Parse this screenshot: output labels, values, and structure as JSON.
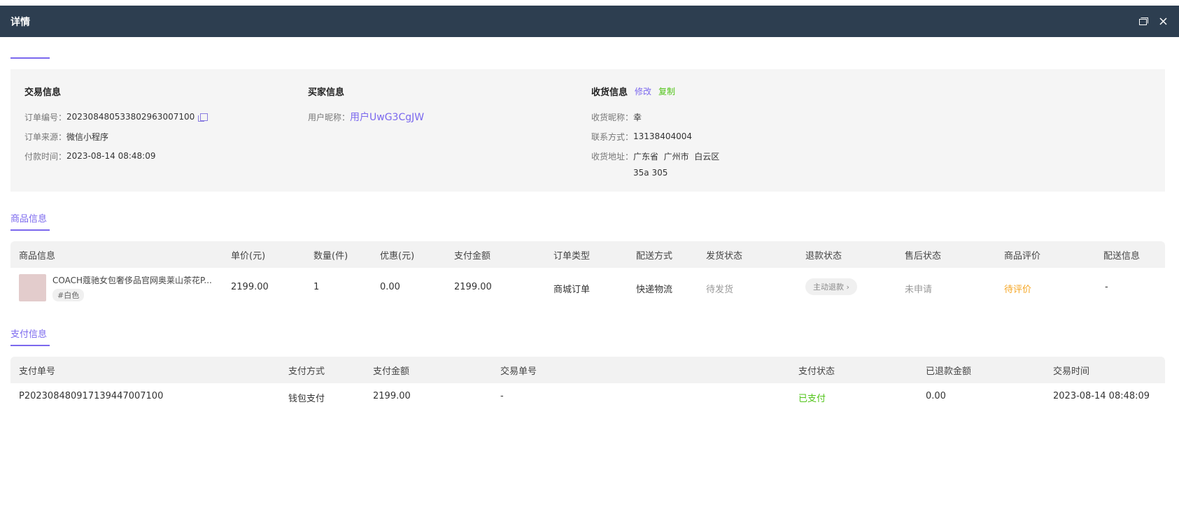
{
  "window": {
    "title": "详情",
    "restore_icon": "restore-window-icon",
    "close_icon": "close-icon"
  },
  "trade": {
    "heading": "交易信息",
    "order_no_label": "订单编号：",
    "order_no": "2023084805338029630071​00",
    "source_label": "订单来源：",
    "source": "微信小程序",
    "pay_time_label": "付款时间：",
    "pay_time": "2023-08-14 08:48:09"
  },
  "buyer": {
    "heading": "买家信息",
    "nick_label": "用户昵称：",
    "nick": "用户UwG3CgJW"
  },
  "receiver": {
    "heading": "收货信息",
    "edit_label": "修改",
    "copy_label": "复制",
    "name_label": "收货昵称：",
    "name": "幸",
    "phone_label": "联系方式：",
    "phone": "13138404004",
    "addr_label": "收货地址：",
    "addr_line1": "广东省  广州市  白云区",
    "addr_line2": "35a 305"
  },
  "goods": {
    "section_title": "商品信息",
    "headers": [
      "商品信息",
      "单价(元)",
      "数量(件)",
      "优惠(元)",
      "支付金额",
      "订单类型",
      "配送方式",
      "发货状态",
      "退款状态",
      "售后状态",
      "商品评价",
      "配送信息"
    ],
    "row": {
      "name": "COACH蔻驰女包奢侈品官网奥莱山茶花P...",
      "sku": "#白色",
      "price": "2199.00",
      "qty": "1",
      "discount": "0.00",
      "paid": "2199.00",
      "order_type": "商城订单",
      "delivery": "快递物流",
      "ship_status": "待发货",
      "refund_button": "主动退款",
      "aftersale": "未申请",
      "review": "待评价",
      "delivery_info": "-"
    }
  },
  "payment": {
    "section_title": "支付信息",
    "headers": [
      "支付单号",
      "支付方式",
      "支付金额",
      "交易单号",
      "支付状态",
      "已退款金额",
      "交易时间"
    ],
    "row": {
      "pay_no": "P2023084809171394470071​00",
      "method": "钱包支付",
      "amount": "2199.00",
      "trade_no": "-",
      "status": "已支付",
      "refunded": "0.00",
      "time": "2023-08-14 08:48:09"
    }
  },
  "colors": {
    "header_bg": "#2d3e50",
    "accent": "#7b68ee",
    "success": "#52c41a",
    "warning": "#f5a623"
  }
}
